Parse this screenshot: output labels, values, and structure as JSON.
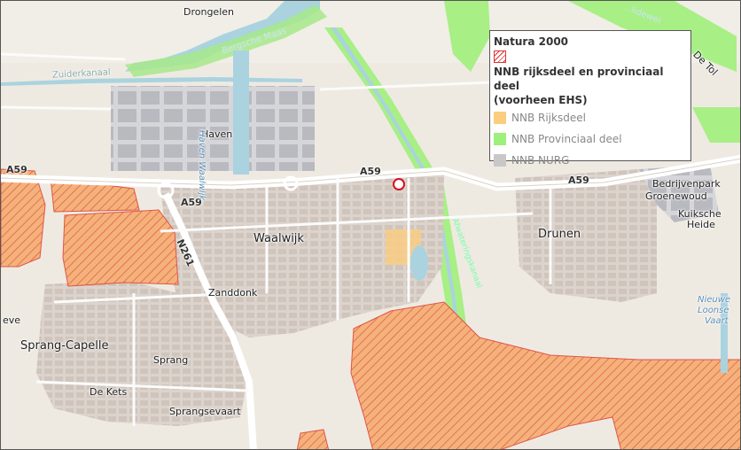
{
  "places": {
    "drongelen": "Drongelen",
    "haven": "Haven",
    "waalwijk": "Waalwijk",
    "drunen": "Drunen",
    "zanddonk": "Zanddonk",
    "sprang_capelle": "Sprang-Capelle",
    "sprang": "Sprang",
    "de_kets": "De Kets",
    "sprangsevaart": "Sprangsevaart",
    "bedrijvenpark_1": "Bedrijvenpark",
    "bedrijvenpark_2": "Groenewoud",
    "kuiksche_1": "Kuiksche",
    "kuiksche_2": "Heide",
    "nieuwe_1": "Nieuwe",
    "nieuwe_2": "Loonse",
    "nieuwe_3": "Vaart",
    "eve": "eve",
    "de_tol": "De Tol"
  },
  "roads": {
    "a59_west": "A59",
    "a59_south": "A59",
    "a59_center": "A59",
    "a59_east": "A59",
    "n261": "N261"
  },
  "water": {
    "bergsche_maas": "Bergsche Maas",
    "zuiderkanaal": "Zuiderkanaal",
    "havenwaalwijk": "Haven Waalwijk",
    "afwateringskanaal": "Afwateringskanaal",
    "lidewei": "..lidewei"
  },
  "legend": {
    "natura_title": "Natura 2000",
    "nnb_title_1": "NNB rijksdeel en provinciaal deel",
    "nnb_title_2": "(voorheen EHS)",
    "rijksdeel": "NNB Rijksdeel",
    "provinciaal": "NNB Provinciaal deel",
    "nurg": "NNB NURG"
  },
  "colors": {
    "natura_hatch": "#d33333",
    "nnb_rijksdeel": "#fbcd7f",
    "nnb_provinciaal": "#9df07a",
    "nnb_nurg": "#c8c8c8",
    "water": "#aad3df",
    "built": "#d9d0c9",
    "industrial": "#cfcfd6",
    "poi_marker": "#d8101e"
  }
}
